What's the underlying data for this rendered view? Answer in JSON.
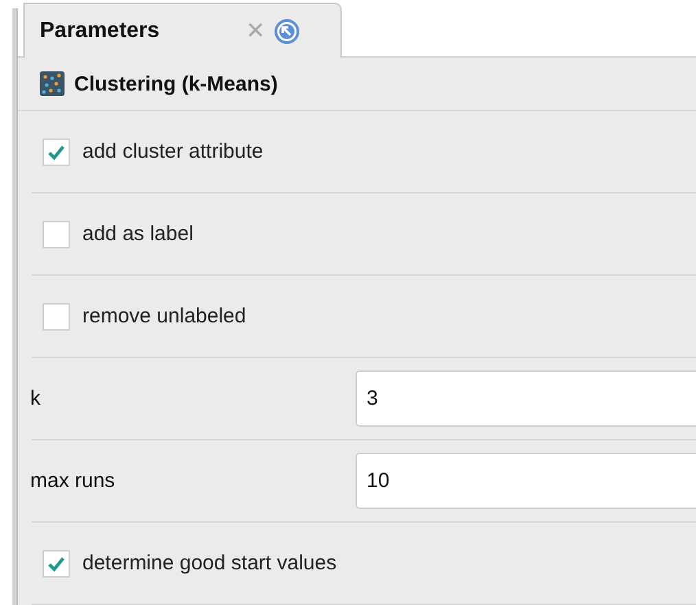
{
  "tab": {
    "title": "Parameters",
    "close": "✕"
  },
  "operator": {
    "name": "Clustering (k-Means)"
  },
  "parameters": [
    {
      "kind": "checkbox",
      "label": "add cluster attribute",
      "checked": true
    },
    {
      "kind": "checkbox",
      "label": "add as label",
      "checked": false
    },
    {
      "kind": "checkbox",
      "label": "remove unlabeled",
      "checked": false
    },
    {
      "kind": "number",
      "label": "k",
      "value": "3"
    },
    {
      "kind": "number",
      "label": "max runs",
      "value": "10"
    },
    {
      "kind": "checkbox",
      "label": "determine good start values",
      "checked": true
    }
  ]
}
